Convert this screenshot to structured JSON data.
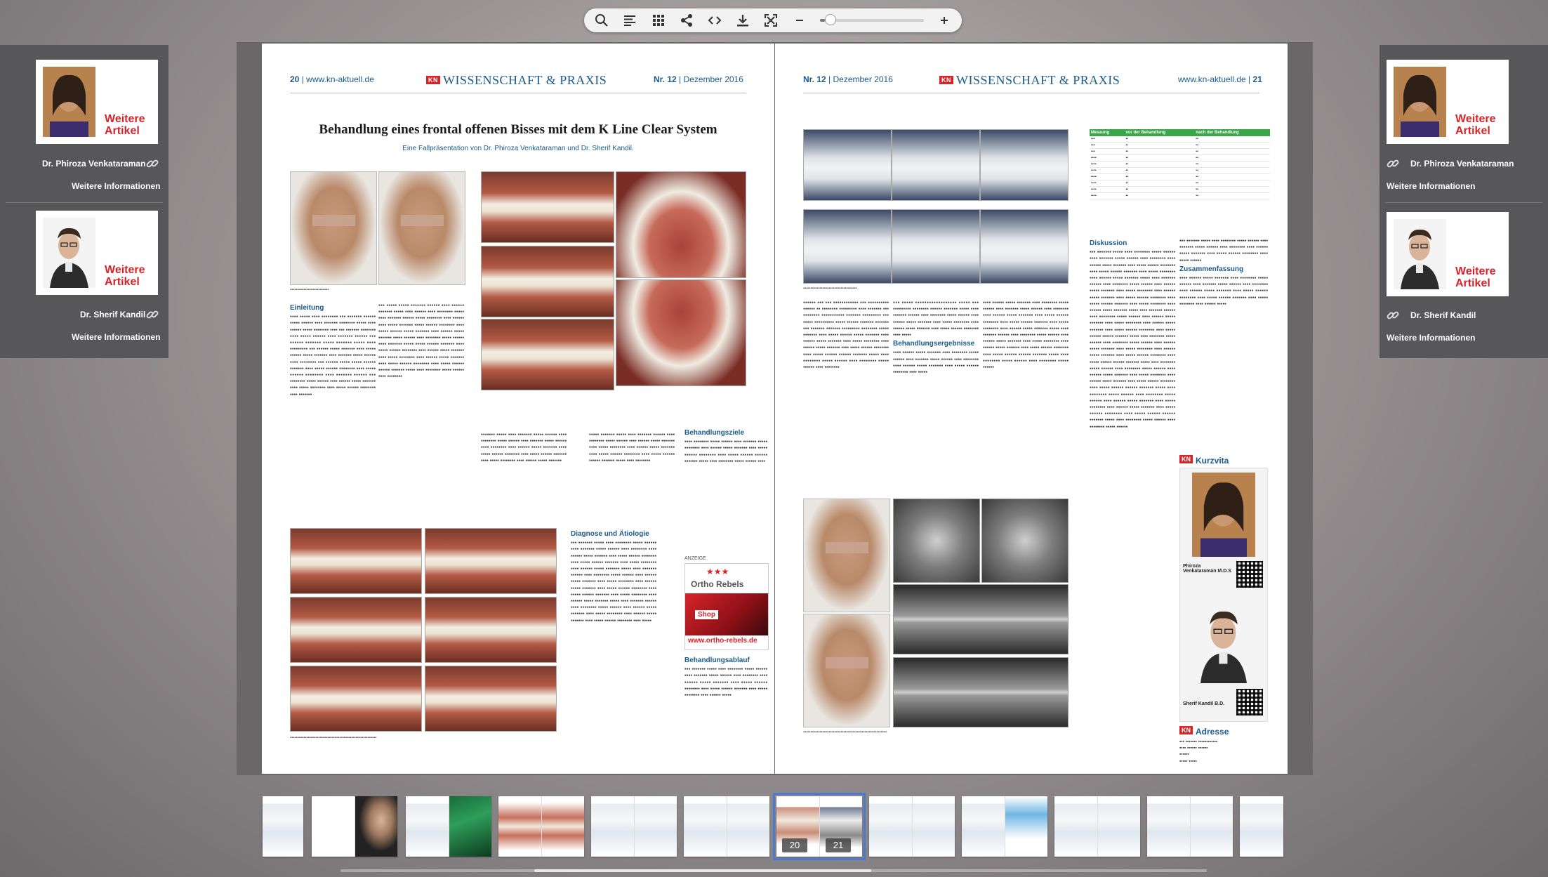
{
  "toolbar": {
    "icons": [
      "search-icon",
      "toc-icon",
      "grid-icon",
      "share-icon",
      "embed-icon",
      "download-icon",
      "fullscreen-icon",
      "zoom-out-icon",
      "zoom-in-icon"
    ],
    "zoom": 0.05
  },
  "authors_left": [
    {
      "more": "Weitere Artikel",
      "name": "Dr. Phiroza Venkataraman",
      "info": "Weitere Informationen"
    },
    {
      "more": "Weitere Artikel",
      "name": "Dr. Sherif Kandil",
      "info": "Weitere Informationen"
    }
  ],
  "authors_right": [
    {
      "more": "Weitere Artikel",
      "name": "Dr. Phiroza Venkataraman",
      "info": "Weitere Informationen"
    },
    {
      "more": "Weitere Artikel",
      "name": "Dr. Sherif Kandil",
      "info": "Weitere Informationen"
    }
  ],
  "page_left": {
    "page_no": "20",
    "site": "www.kn-aktuell.de",
    "section_logo": "KN",
    "section": "WISSENSCHAFT & PRAXIS",
    "issue": "Nr. 12",
    "date": "Dezember 2016",
    "title": "Behandlung eines frontal offenen Bisses mit dem K Line Clear System",
    "subtitle": "Eine Fallpräsentation von Dr. Phiroza Venkataraman und Dr. Sherif Kandil.",
    "sections": [
      "Einleitung",
      "Diagnose und Ätiologie",
      "Behandlungsziele",
      "Behandlungsablauf"
    ],
    "ad_label": "ANZEIGE",
    "ad_brand": "Ortho Rebels",
    "ad_shop": "Shop",
    "ad_url": "www.ortho-rebels.de"
  },
  "page_right": {
    "issue": "Nr. 12",
    "date": "Dezember 2016",
    "section_logo": "KN",
    "section": "WISSENSCHAFT & PRAXIS",
    "site": "www.kn-aktuell.de",
    "page_no": "21",
    "table_headers": [
      "Messung",
      "vor der Behandlung",
      "nach der Behandlung"
    ],
    "sections": [
      "Diskussion",
      "Zusammenfassung",
      "Behandlungsergebnisse"
    ],
    "kurzvita": "Kurzvita",
    "adresse": "Adresse",
    "vita_names": [
      "Phiroza Venkataraman M.D.S",
      "Sherif Kandil B.D."
    ]
  },
  "thumbnails": {
    "active_pages": [
      "20",
      "21"
    ]
  }
}
